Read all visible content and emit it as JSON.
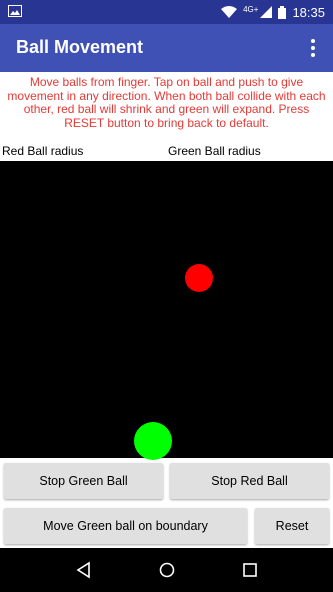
{
  "status_bar": {
    "time": "18:35",
    "network": "4G+",
    "icons": [
      "image-icon",
      "wifi-icon",
      "signal-icon",
      "battery-icon"
    ]
  },
  "app_bar": {
    "title": "Ball Movement",
    "menu_icon": "overflow-menu-icon"
  },
  "instructions": "Move balls from finger. Tap on ball and push to give movement in any direction. When both ball collide with each other, red ball will shrink and green will expand. Press RESET button to bring back to default.",
  "labels": {
    "red_radius": "Red Ball radius",
    "green_radius": "Green Ball radius"
  },
  "balls": {
    "red_color": "#ff0000",
    "green_color": "#00ff00"
  },
  "buttons": {
    "stop_green": "Stop Green Ball",
    "stop_red": "Stop Red Ball",
    "move_green_boundary": "Move Green ball on boundary",
    "reset": "Reset"
  },
  "nav_bar": {
    "icons": [
      "back-icon",
      "home-icon",
      "recents-icon"
    ]
  }
}
